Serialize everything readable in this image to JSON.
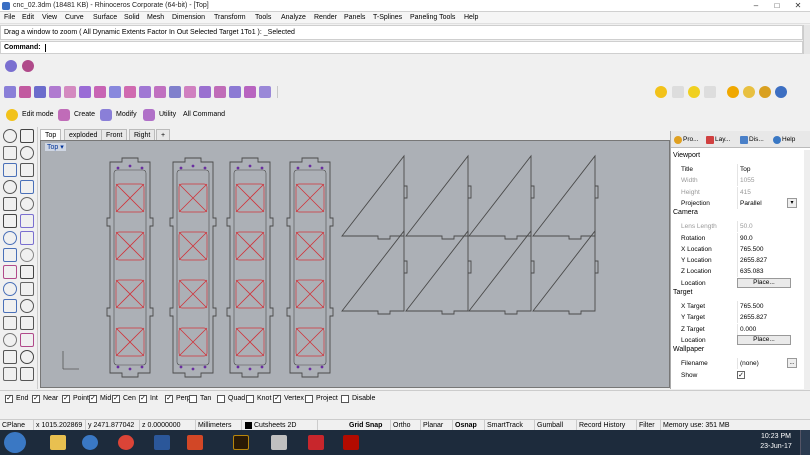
{
  "window": {
    "title": "cnc_02.3dm (18481 KB) - Rhinoceros Corporate (64-bit) - [Top]",
    "minimize": "–",
    "maximize": "□",
    "close": "✕"
  },
  "menu": [
    "File",
    "Edit",
    "View",
    "Curve",
    "Surface",
    "Solid",
    "Mesh",
    "Dimension",
    "Transform",
    "Tools",
    "Analyze",
    "Render",
    "Panels",
    "T-Splines",
    "Paneling Tools",
    "Help"
  ],
  "command": {
    "history": "Drag a window to zoom ( All  Dynamic  Extents  Factor  In  Out  Selected  Target  1To1 ): _Selected",
    "prompt": "Command:"
  },
  "toolbar_icons": [
    "rhino-icon",
    "surface-icon",
    "curve-icon",
    "solid-icon",
    "mesh-icon",
    "render-icon",
    "sun-icon",
    "light-icon"
  ],
  "command_tabs": [
    {
      "label": "Edit mode",
      "icon": "edit-mode-icon"
    },
    {
      "label": "Create",
      "icon": "create-icon"
    },
    {
      "label": "Modify",
      "icon": "modify-icon"
    },
    {
      "label": "Utility",
      "icon": "utility-icon"
    },
    {
      "label": "All Command",
      "icon": ""
    }
  ],
  "viewport_tabs": [
    "Top",
    "exploded",
    "Front",
    "Right",
    "+"
  ],
  "viewport": {
    "label": "Top ▾"
  },
  "panel": {
    "tabs": [
      "Pro...",
      "Lay...",
      "Dis...",
      "Help"
    ],
    "viewport_section": "Viewport",
    "viewport_rows": [
      {
        "label": "Title",
        "value": "Top",
        "disabled": false
      },
      {
        "label": "Width",
        "value": "1055",
        "disabled": true
      },
      {
        "label": "Height",
        "value": "415",
        "disabled": true
      },
      {
        "label": "Projection",
        "value": "Parallel",
        "disabled": false
      }
    ],
    "camera_section": "Camera",
    "camera_rows": [
      {
        "label": "Lens Length",
        "value": "50.0",
        "disabled": true
      },
      {
        "label": "Rotation",
        "value": "90.0",
        "disabled": false
      },
      {
        "label": "X Location",
        "value": "765.500",
        "disabled": false
      },
      {
        "label": "Y Location",
        "value": "2655.827",
        "disabled": false
      },
      {
        "label": "Z Location",
        "value": "635.083",
        "disabled": false
      },
      {
        "label": "Location",
        "value": "",
        "disabled": false
      }
    ],
    "place_button": "Place...",
    "target_section": "Target",
    "target_rows": [
      {
        "label": "X Target",
        "value": "765.500",
        "disabled": false
      },
      {
        "label": "Y Target",
        "value": "2655.827",
        "disabled": false
      },
      {
        "label": "Z Target",
        "value": "0.000",
        "disabled": false
      },
      {
        "label": "Location",
        "value": "",
        "disabled": false
      }
    ],
    "wallpaper_section": "Wallpaper",
    "wallpaper_rows": [
      {
        "label": "Filename",
        "value": "(none)",
        "disabled": false
      },
      {
        "label": "Show",
        "value": "✓",
        "disabled": false
      }
    ],
    "more_button": "..."
  },
  "osnap": [
    {
      "label": "End",
      "checked": true
    },
    {
      "label": "Near",
      "checked": true
    },
    {
      "label": "Point",
      "checked": true
    },
    {
      "label": "Mid",
      "checked": true
    },
    {
      "label": "Cen",
      "checked": true
    },
    {
      "label": "Int",
      "checked": true
    },
    {
      "label": "Perp",
      "checked": true
    },
    {
      "label": "Tan",
      "checked": false
    },
    {
      "label": "Quad",
      "checked": false
    },
    {
      "label": "Knot",
      "checked": false
    },
    {
      "label": "Vertex",
      "checked": true
    },
    {
      "label": "Project",
      "checked": false
    },
    {
      "label": "Disable",
      "checked": false
    }
  ],
  "status": {
    "cplane": "CPlane",
    "x": "x 1015.202869",
    "y": "y 2471.877042",
    "z": "z 0.0000000",
    "units": "Millimeters",
    "layer": "Cutsheets 2D",
    "layer_color": "#000000",
    "toggles": [
      {
        "label": "Grid Snap",
        "bold": true
      },
      {
        "label": "Ortho",
        "bold": false
      },
      {
        "label": "Planar",
        "bold": false
      },
      {
        "label": "Osnap",
        "bold": true
      },
      {
        "label": "SmartTrack",
        "bold": false
      },
      {
        "label": "Gumball",
        "bold": false
      },
      {
        "label": "Record History",
        "bold": false
      },
      {
        "label": "Filter",
        "bold": false
      }
    ],
    "memory": "Memory use: 351 MB"
  },
  "taskbar": {
    "apps": [
      "explorer-icon",
      "media-icon",
      "chrome-icon",
      "word-icon",
      "powerpoint-icon",
      "muse-icon",
      "rhino-icon",
      "autocad-icon",
      "acrobat-icon"
    ],
    "time": "10:23 PM",
    "date": "23-Jun-17"
  },
  "colors": {
    "viewport_bg": "#acb0b6",
    "outline": "#4a4a4a",
    "cut_red": "#d0333a",
    "hole_purple": "#6a2fa0"
  }
}
